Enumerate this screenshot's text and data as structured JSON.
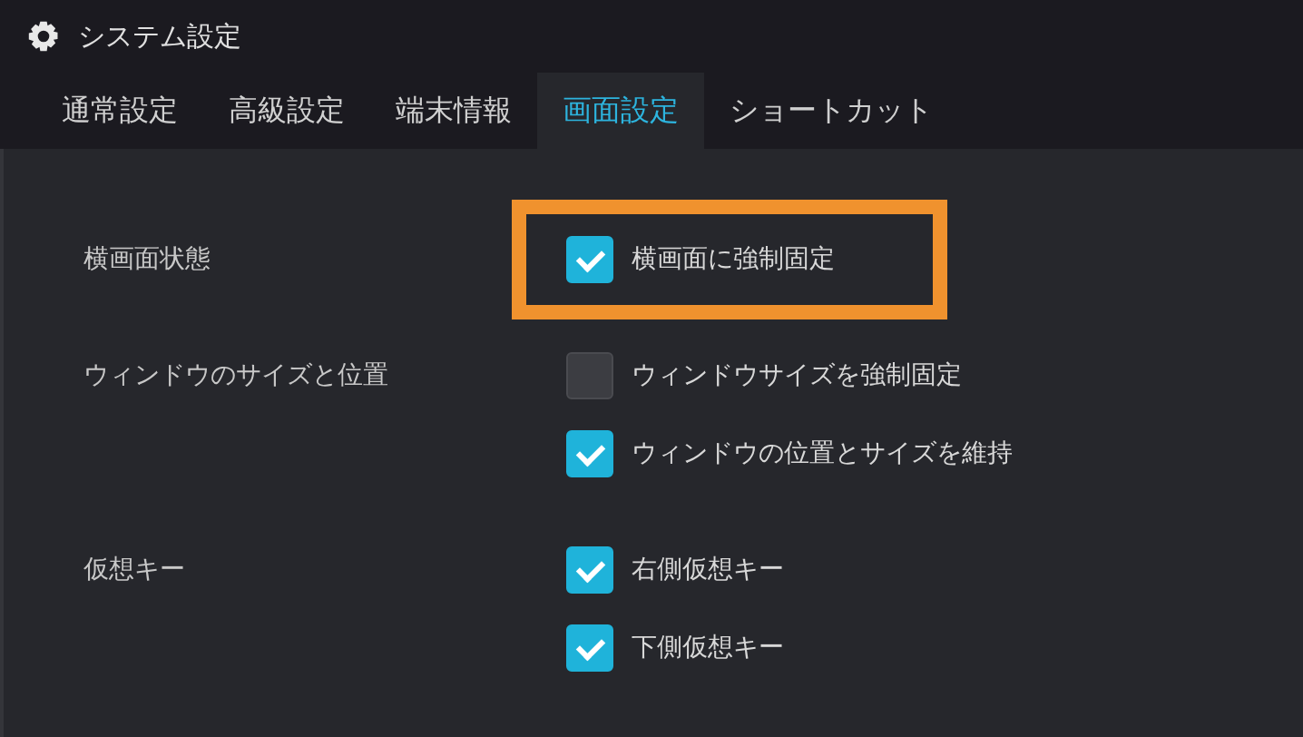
{
  "window": {
    "title": "システム設定"
  },
  "tabs": [
    {
      "label": "通常設定",
      "selected": false
    },
    {
      "label": "高級設定",
      "selected": false
    },
    {
      "label": "端末情報",
      "selected": false
    },
    {
      "label": "画面設定",
      "selected": true
    },
    {
      "label": "ショートカット",
      "selected": false
    }
  ],
  "settings": [
    {
      "label": "横画面状態",
      "options": [
        {
          "label": "横画面に強制固定",
          "checked": true,
          "highlighted": true
        }
      ]
    },
    {
      "label": "ウィンドウのサイズと位置",
      "options": [
        {
          "label": "ウィンドウサイズを強制固定",
          "checked": false,
          "highlighted": false
        },
        {
          "label": "ウィンドウの位置とサイズを維持",
          "checked": true,
          "highlighted": false
        }
      ]
    },
    {
      "label": "仮想キー",
      "options": [
        {
          "label": "右側仮想キー",
          "checked": true,
          "highlighted": false
        },
        {
          "label": "下側仮想キー",
          "checked": true,
          "highlighted": false
        }
      ]
    }
  ]
}
